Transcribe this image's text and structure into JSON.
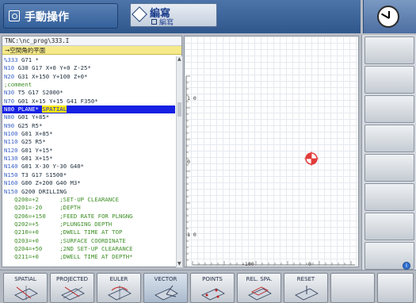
{
  "header": {
    "mode_main": "手動操作",
    "mode_prog": "編寫",
    "mode_prog_sub": "編寫"
  },
  "program": {
    "path": "TNC:\\nc_prog\\333.I",
    "context": "→空間角的平面",
    "lines": [
      {
        "n": "%333",
        "text": " G71 *",
        "type": "code"
      },
      {
        "n": "N10",
        "text": " G30 G17 X+0 Y+0 Z-25*",
        "type": "code"
      },
      {
        "n": "N20",
        "text": " G31 X+150 Y+100 Z+0*",
        "type": "code"
      },
      {
        "n": "",
        "text": ";comment",
        "type": "comment"
      },
      {
        "n": "N30",
        "text": " T5 G17 S2000*",
        "type": "code"
      },
      {
        "n": "N70",
        "text": " G01 X+15 Y+15 G41 F350*",
        "type": "code"
      },
      {
        "n": "N80",
        "text": " PLANE* ",
        "hl": "SPATIAL",
        "type": "selected"
      },
      {
        "n": "N80",
        "text": " G01 Y+85*",
        "type": "code"
      },
      {
        "n": "N90",
        "text": " G25 R5*",
        "type": "code"
      },
      {
        "n": "N100",
        "text": " G01 X+85*",
        "type": "code"
      },
      {
        "n": "N110",
        "text": " G25 R5*",
        "type": "code"
      },
      {
        "n": "N120",
        "text": " G01 Y+15*",
        "type": "code"
      },
      {
        "n": "N130",
        "text": " G01 X+15*",
        "type": "code"
      },
      {
        "n": "N140",
        "text": " G01 X-30 Y-30 G40*",
        "type": "code"
      },
      {
        "n": "N150",
        "text": " T3 G17 S1500*",
        "type": "code"
      },
      {
        "n": "N160",
        "text": " G00 Z+200 G40 M3*",
        "type": "code"
      },
      {
        "n": "N150",
        "text": " G200 DRILLING",
        "type": "code"
      },
      {
        "n": "",
        "text": "   Q200=+2      ;SET-UP CLEARANCE",
        "type": "param"
      },
      {
        "n": "",
        "text": "   Q201=-20     ;DEPTH",
        "type": "param"
      },
      {
        "n": "",
        "text": "   Q206=+150    ;FEED RATE FOR PLNGNG",
        "type": "param"
      },
      {
        "n": "",
        "text": "   Q202=+5      ;PLUNGING DEPTH",
        "type": "param"
      },
      {
        "n": "",
        "text": "   Q210=+0      ;DWELL TIME AT TOP",
        "type": "param"
      },
      {
        "n": "",
        "text": "   Q203=+0      ;SURFACE COORDINATE",
        "type": "param"
      },
      {
        "n": "",
        "text": "   Q204=+50     ;2ND SET-UP CLEARANCE",
        "type": "param"
      },
      {
        "n": "",
        "text": "   Q211=+0      ;DWELL TIME AT DEPTH*",
        "type": "param"
      }
    ]
  },
  "graphic": {
    "label_y1": "1 0",
    "label_y2": "0",
    "label_y3": "1 0",
    "label_x1": "-100",
    "label_x2": "0"
  },
  "softkeys": [
    {
      "label": "SPATIAL"
    },
    {
      "label": "PROJECTED"
    },
    {
      "label": "EULER"
    },
    {
      "label": "VECTOR"
    },
    {
      "label": "POINTS"
    },
    {
      "label": "REL. SPA."
    },
    {
      "label": "RESET"
    }
  ],
  "colors": {
    "selected_line_bg": "#1621e3",
    "highlight": "#ffec00",
    "line_number": "#3b63c8",
    "comment": "#3f8f28",
    "header_blue": "#2f578c",
    "origin_marker": "#e23b3b"
  }
}
